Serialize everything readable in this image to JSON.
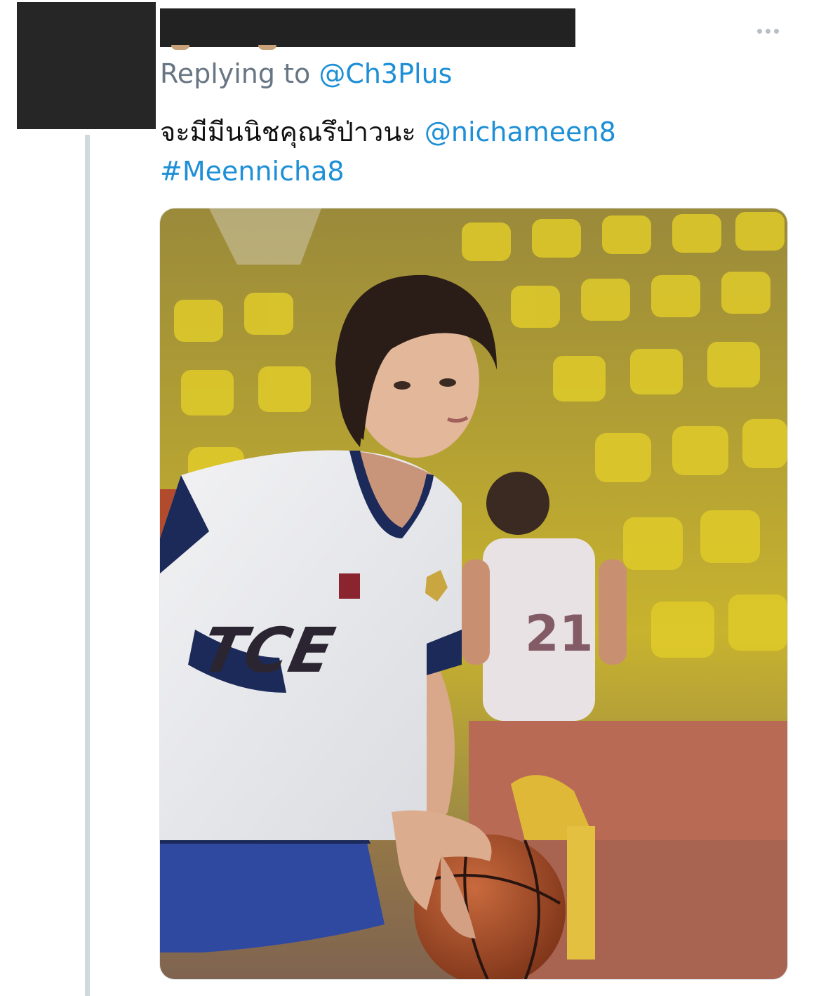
{
  "tweet": {
    "replying_prefix": "Replying to ",
    "replying_handle": "@Ch3Plus",
    "text": "จะมีมีนนิชคุณรึป่าวนะ ",
    "mention": "@nichameen8",
    "hashtag": "#Meennicha8",
    "media": {
      "description_icon": "photo",
      "jersey_text": "TCE",
      "background_jersey_number": "21"
    }
  },
  "icons": {
    "more": "more-horizontal-icon"
  },
  "colors": {
    "link": "#1d8fd6",
    "secondary_text": "#687684",
    "thread_line": "#cfd9de"
  }
}
